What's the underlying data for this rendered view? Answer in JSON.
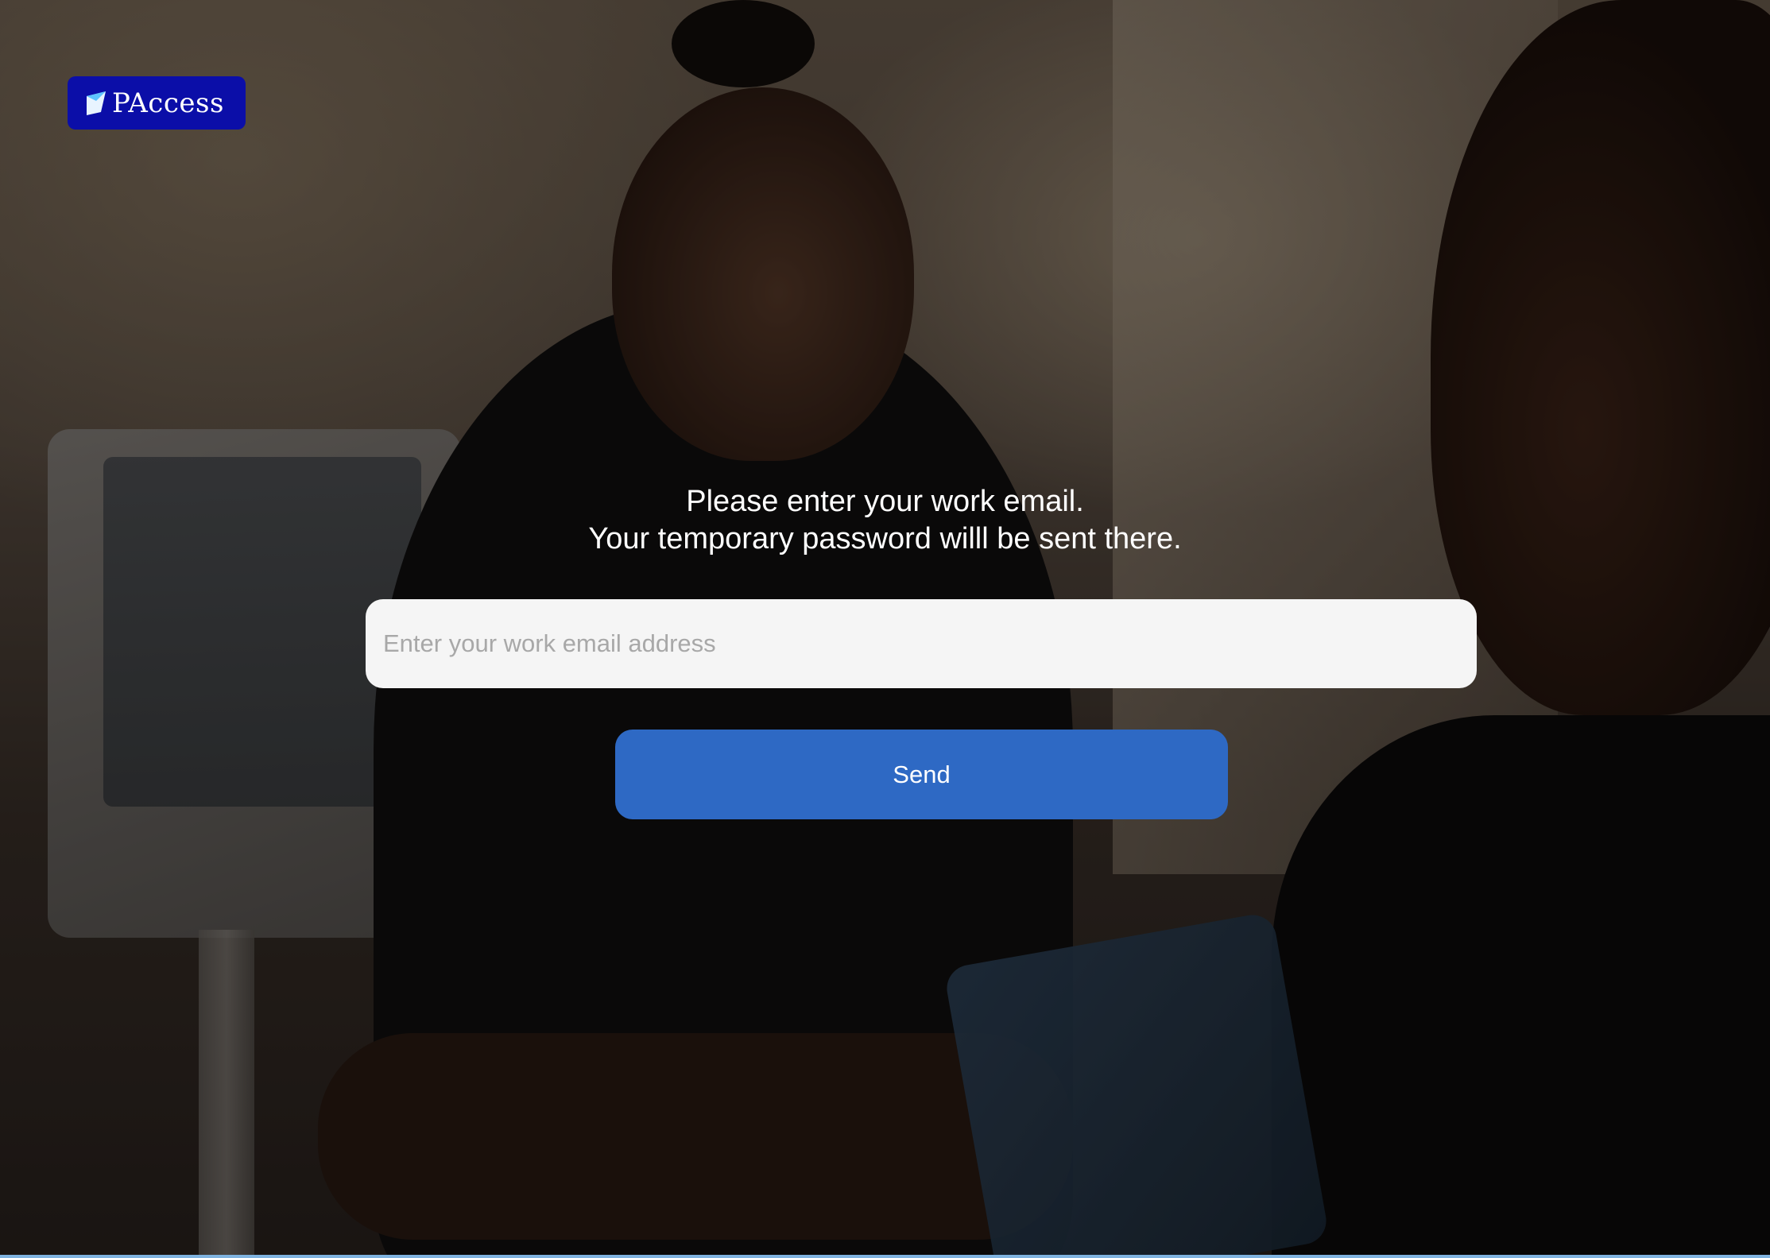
{
  "logo": {
    "text": "PAccess",
    "background_color": "#0b0ea8",
    "icon": "paccess-logo-mark-icon"
  },
  "message": {
    "line1": "Please enter your work email.",
    "line2": "Your temporary password willl be sent there."
  },
  "email": {
    "placeholder": "Enter your work email address",
    "value": ""
  },
  "send_button": {
    "label": "Send",
    "color": "#2e69c4"
  },
  "background": {
    "description_icon": "nurse-patient-photo"
  }
}
